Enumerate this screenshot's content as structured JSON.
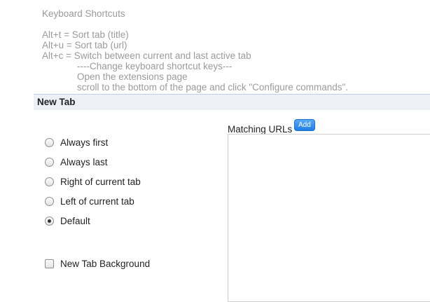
{
  "shortcuts": {
    "title": "Keyboard Shortcuts",
    "lines": [
      "Alt+t = Sort tab (title)",
      "Alt+u = Sort tab (url)",
      "Alt+c = Switch between current and last active tab"
    ],
    "indented": [
      "----Change keyboard shortcut keys---",
      "Open the extensions page",
      "scroll to the bottom of the page and click \"Configure commands\"."
    ]
  },
  "new_tab": {
    "header": "New Tab",
    "options": [
      {
        "label": "Always first",
        "checked": false
      },
      {
        "label": "Always last",
        "checked": false
      },
      {
        "label": "Right of current tab",
        "checked": false
      },
      {
        "label": "Left of current tab",
        "checked": false
      },
      {
        "label": "Default",
        "checked": true
      }
    ],
    "background_label": "New Tab Background",
    "background_checked": false,
    "matching_label": "Matching URLs",
    "add_label": "Add",
    "matching_value": ""
  }
}
